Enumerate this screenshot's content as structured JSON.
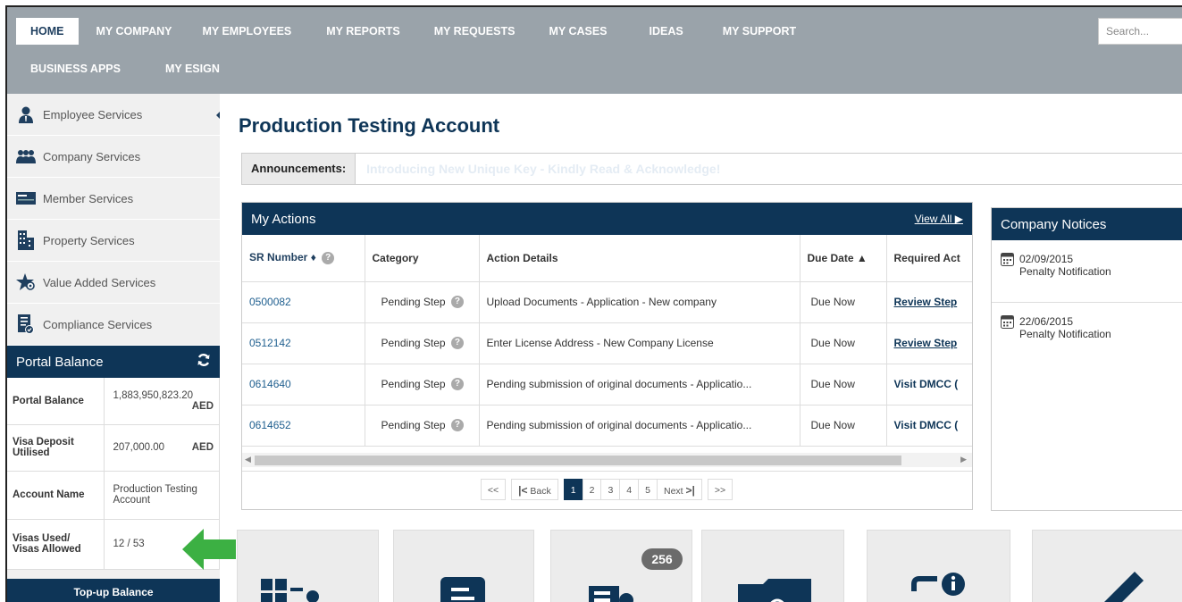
{
  "nav": {
    "row1": [
      "HOME",
      "MY COMPANY",
      "MY EMPLOYEES",
      "MY REPORTS",
      "MY REQUESTS",
      "MY CASES",
      "IDEAS",
      "MY SUPPORT"
    ],
    "row2": [
      "BUSINESS APPS",
      "MY ESIGN"
    ],
    "search_placeholder": "Search..."
  },
  "sidebar": {
    "services": [
      {
        "label": "Employee Services",
        "icon": "employee-icon"
      },
      {
        "label": "Company Services",
        "icon": "company-group-icon"
      },
      {
        "label": "Member Services",
        "icon": "member-card-icon"
      },
      {
        "label": "Property Services",
        "icon": "building-icon"
      },
      {
        "label": "Value Added Services",
        "icon": "star-gear-icon"
      },
      {
        "label": "Compliance Services",
        "icon": "compliance-doc-icon"
      }
    ],
    "portal_balance": {
      "title": "Portal Balance",
      "rows": [
        {
          "key": "Portal Balance",
          "value": "1,883,950,823.20",
          "unit": "AED"
        },
        {
          "key": "Visa Deposit Utilised",
          "value": "207,000.00",
          "unit": "AED"
        },
        {
          "key": "Account Name",
          "value": "Production Testing Account",
          "unit": ""
        },
        {
          "key": "Visas Used/ Visas Allowed",
          "value": "12 / 53",
          "unit": ""
        }
      ]
    },
    "topup_label": "Top-up Balance"
  },
  "main": {
    "title": "Production Testing Account",
    "announcements_label": "Announcements:",
    "announcement_text": "Introducing New Unique Key - Kindly Read & Acknowledge!"
  },
  "actions": {
    "title": "My Actions",
    "view_all": "View All ▶",
    "columns": [
      "SR Number",
      "Category",
      "Action Details",
      "Due Date",
      "Required Act"
    ],
    "rows": [
      {
        "sr": "0500082",
        "category": "Pending Step",
        "details": "Upload Documents - Application - New company",
        "due": "Due Now",
        "req": "Review Step"
      },
      {
        "sr": "0512142",
        "category": "Pending Step",
        "details": "Enter License Address - New Company License",
        "due": "Due Now",
        "req": "Review Step"
      },
      {
        "sr": "0614640",
        "category": "Pending Step",
        "details": "Pending submission of original documents - Applicatio...",
        "due": "Due Now",
        "req": "Visit DMCC ("
      },
      {
        "sr": "0614652",
        "category": "Pending Step",
        "details": "Pending submission of original documents - Applicatio...",
        "due": "Due Now",
        "req": "Visit DMCC ("
      }
    ],
    "pager": [
      "<<",
      "Back",
      "1",
      "2",
      "3",
      "4",
      "5",
      "Next",
      ">>"
    ]
  },
  "notices": {
    "title": "Company Notices",
    "items": [
      {
        "date": "02/09/2015",
        "text": "Penalty Notification"
      },
      {
        "date": "22/06/2015",
        "text": "Penalty Notification"
      }
    ]
  },
  "tiles": {
    "badge": "256"
  },
  "colors": {
    "navy": "#0e3557",
    "nav_gray": "#9aa3aa",
    "arrow_green": "#3cb043"
  }
}
